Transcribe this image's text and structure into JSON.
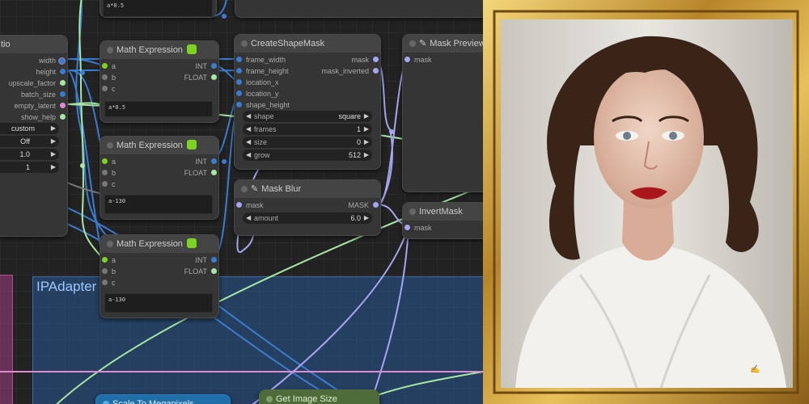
{
  "colors": {
    "accent_group": "#285896",
    "wire_blue": "#3b7ccf",
    "wire_green": "#a8e6a3",
    "wire_lavender": "#a6a6f0",
    "wire_pink": "#e08bd1",
    "frame_gold": "#c9a13b"
  },
  "partial_node": {
    "title": "tio",
    "outputs": [
      "width",
      "height",
      "upscale_factor",
      "batch_size",
      "empty_latent",
      "show_help"
    ],
    "widgets": [
      "custom",
      "Off",
      "1.0",
      "1"
    ]
  },
  "math_expr_top": {
    "expression": "a*0.5"
  },
  "math_expr_1": {
    "title": "Math Expression",
    "inputs": [
      "a",
      "b",
      "c"
    ],
    "outputs": [
      "INT",
      "FLOAT"
    ],
    "expression": "a*0.5"
  },
  "math_expr_2": {
    "title": "Math Expression",
    "inputs": [
      "a",
      "b",
      "c"
    ],
    "outputs": [
      "INT",
      "FLOAT"
    ],
    "expression": "a-130"
  },
  "math_expr_3": {
    "title": "Math Expression",
    "inputs": [
      "a",
      "b",
      "c"
    ],
    "outputs": [
      "INT",
      "FLOAT"
    ],
    "expression": "a-130"
  },
  "create_shape_mask": {
    "title": "CreateShapeMask",
    "inputs": [
      "frame_width",
      "frame_height",
      "location_x",
      "location_y",
      "shape_height"
    ],
    "outputs": [
      "mask",
      "mask_inverted"
    ],
    "widgets": [
      {
        "label": "shape",
        "value": "square"
      },
      {
        "label": "frames",
        "value": "1"
      },
      {
        "label": "size",
        "value": "0"
      },
      {
        "label": "grow",
        "value": "512"
      }
    ]
  },
  "mask_blur": {
    "title": "Mask Blur",
    "inputs": [
      "mask"
    ],
    "outputs": [
      "MASK"
    ],
    "widget": {
      "label": "amount",
      "value": "6.0"
    }
  },
  "mask_preview": {
    "title": "Mask Preview",
    "inputs": [
      "mask"
    ]
  },
  "invert_mask": {
    "title": "InvertMask",
    "inputs": [
      "mask"
    ]
  },
  "ipadapter_group": {
    "title": "IPAdapter"
  },
  "scale_node": {
    "title": "Scale To Megapixels"
  },
  "get_image_size": {
    "title": "Get Image Size"
  }
}
